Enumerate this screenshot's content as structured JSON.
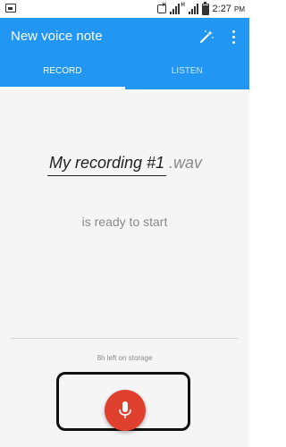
{
  "status_bar": {
    "time": "2:27",
    "ampm": "PM",
    "sim1_tag": "H",
    "sim2_tag": "H",
    "battery_level": 0.85
  },
  "app_bar": {
    "title": "New voice note",
    "tabs": [
      {
        "label": "RECORD",
        "active": true
      },
      {
        "label": "LISTEN",
        "active": false
      }
    ]
  },
  "recorder": {
    "filename": "My recording #1",
    "extension": ".wav",
    "status": "is ready to start",
    "storage_left": "8h left on storage"
  },
  "icons": {
    "wand": "magic-wand-icon",
    "more": "more-vert-icon",
    "mic": "mic-icon"
  },
  "colors": {
    "primary": "#2196f3",
    "record": "#e0412f",
    "background": "#f5f5f5"
  }
}
